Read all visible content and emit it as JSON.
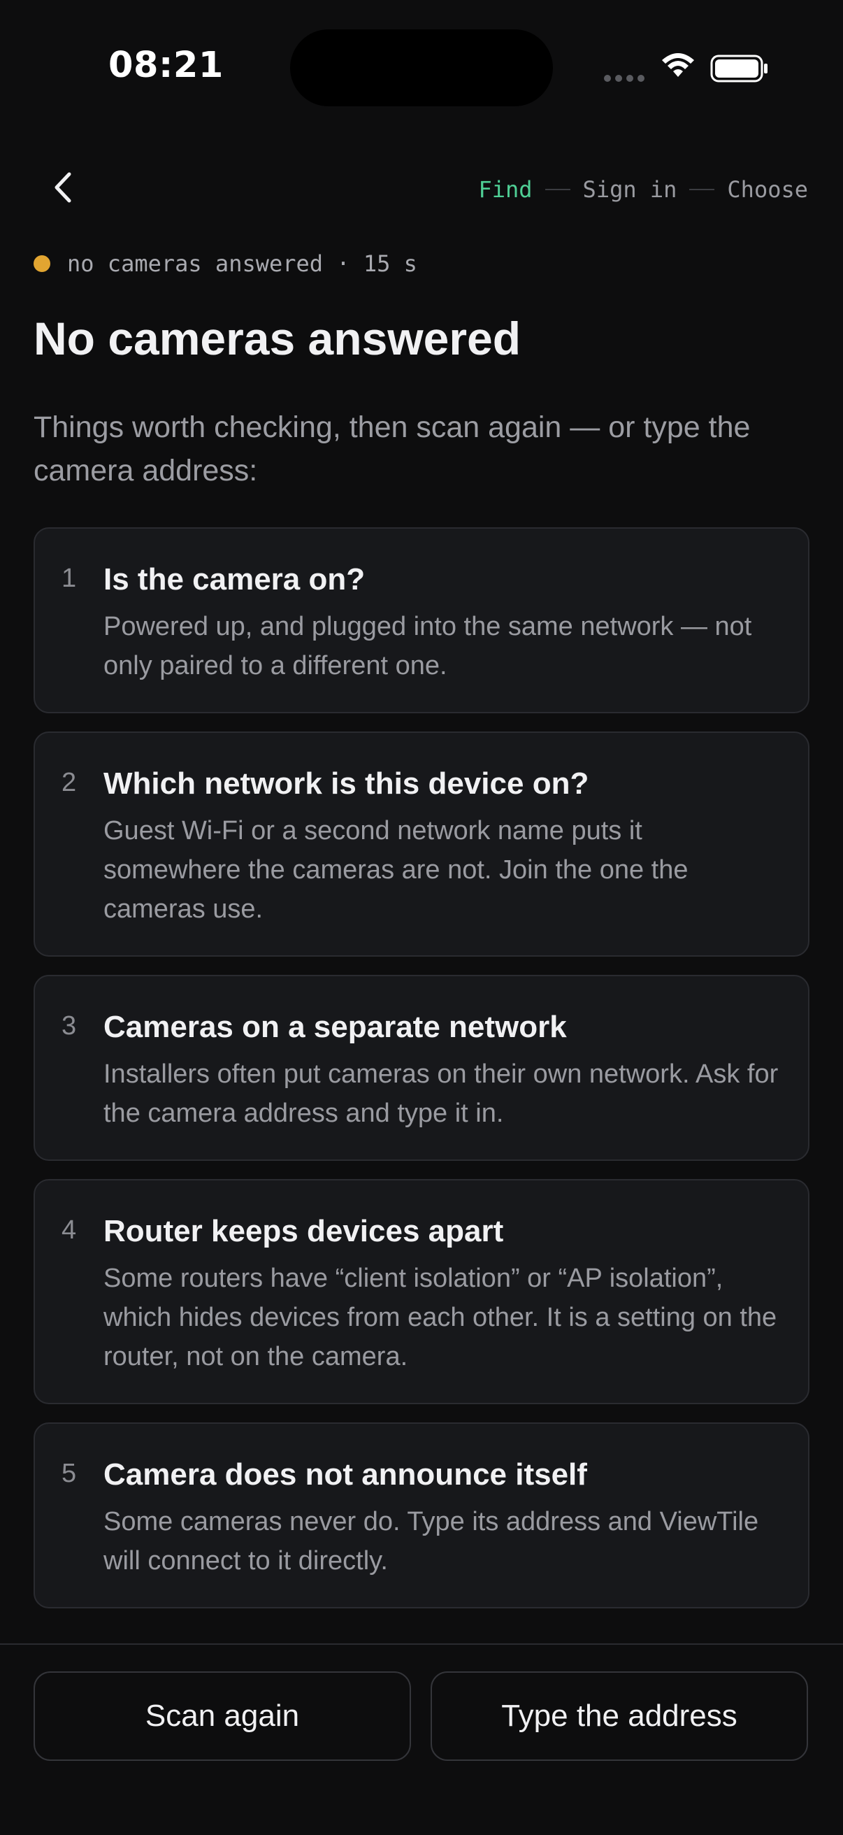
{
  "status_bar": {
    "time": "08:21"
  },
  "nav": {
    "steps": [
      {
        "label": "Find",
        "active": true
      },
      {
        "label": "Sign in",
        "active": false
      },
      {
        "label": "Choose",
        "active": false
      }
    ]
  },
  "scan_status": {
    "text": "no cameras answered · 15 s",
    "dot_color": "#e2a531"
  },
  "page": {
    "title": "No cameras answered",
    "intro": "Things worth checking, then scan again — or type the camera address:"
  },
  "checklist": [
    {
      "number": "1",
      "title": "Is the camera on?",
      "body": "Powered up, and plugged into the same network — not only paired to a different one."
    },
    {
      "number": "2",
      "title": "Which network is this device on?",
      "body": "Guest Wi-Fi or a second network name puts it somewhere the cameras are not. Join the one the cameras use."
    },
    {
      "number": "3",
      "title": "Cameras on a separate network",
      "body": "Installers often put cameras on their own network. Ask for the camera address and type it in."
    },
    {
      "number": "4",
      "title": "Router keeps devices apart",
      "body": "Some routers have “client isolation” or “AP isolation”, which hides devices from each other. It is a setting on the router, not on the camera."
    },
    {
      "number": "5",
      "title": "Camera does not announce itself",
      "body": "Some cameras never do. Type its address and ViewTile will connect to it directly."
    }
  ],
  "actions": {
    "scan_again": "Scan again",
    "type_address": "Type the address"
  },
  "colors": {
    "accent": "#4fcf95",
    "warning": "#e2a531",
    "background": "#0d0d0e",
    "card": "#17181b"
  }
}
